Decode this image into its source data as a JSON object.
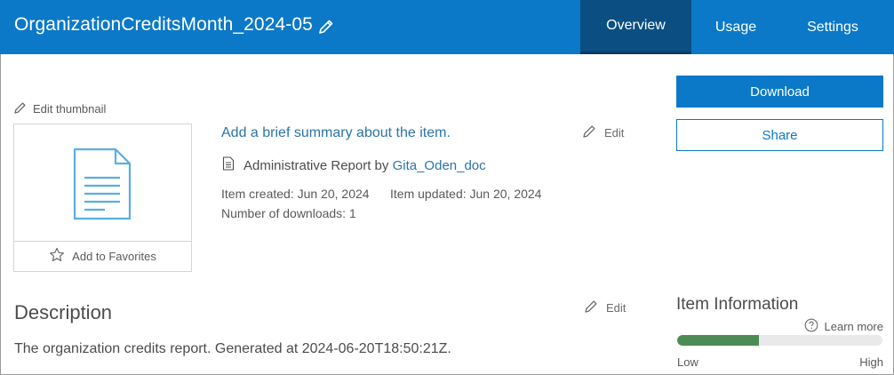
{
  "header": {
    "title": "OrganizationCreditsMonth_2024-05",
    "tabs": [
      {
        "label": "Overview",
        "active": true
      },
      {
        "label": "Usage",
        "active": false
      },
      {
        "label": "Settings",
        "active": false
      }
    ],
    "bg_color": "#0b79c7",
    "active_tab_color": "#0b4f82"
  },
  "thumbnail": {
    "edit_label": "Edit thumbnail",
    "favorites_label": "Add to Favorites"
  },
  "summary": {
    "placeholder_link": "Add a brief summary about the item.",
    "edit_label": "Edit"
  },
  "item": {
    "type_prefix": "Administrative Report by",
    "owner": "Gita_Oden_doc",
    "created": "Item created: Jun 20, 2024",
    "updated": "Item updated: Jun 20, 2024",
    "downloads": "Number of downloads: 1"
  },
  "description": {
    "heading": "Description",
    "edit_label": "Edit",
    "text": "The organization credits report. Generated at 2024-06-20T18:50:21Z."
  },
  "actions": {
    "download_label": "Download",
    "share_label": "Share"
  },
  "item_information": {
    "heading": "Item Information",
    "learn_more": "Learn more",
    "score_fraction": 0.4,
    "low_label": "Low",
    "high_label": "High",
    "fill_color": "#4c8c54"
  },
  "icons": [
    "pencil-icon",
    "document-icon",
    "star-icon",
    "report-icon",
    "help-circle-icon"
  ]
}
